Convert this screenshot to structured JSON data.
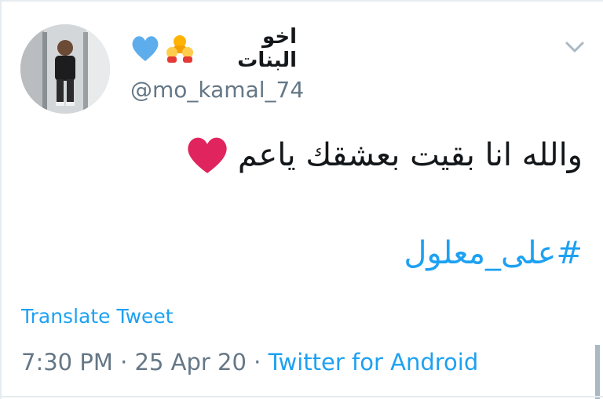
{
  "tweet": {
    "display_name": "اخو البنات",
    "display_name_emojis": [
      "blue-heart",
      "family"
    ],
    "handle": "@mo_kamal_74",
    "text": "والله انا بقيت بعشقك ياعم",
    "text_emoji": "red-heart",
    "hashtag": "#على_معلول",
    "translate_label": "Translate Tweet",
    "time": "7:30 PM",
    "date": "25 Apr 20",
    "separator": "·",
    "source": "Twitter for Android"
  },
  "colors": {
    "link": "#1da1f2",
    "secondary_text": "#657786",
    "primary_text": "#14171a",
    "heart_red": "#e0245e",
    "heart_blue": "#5dadec"
  }
}
